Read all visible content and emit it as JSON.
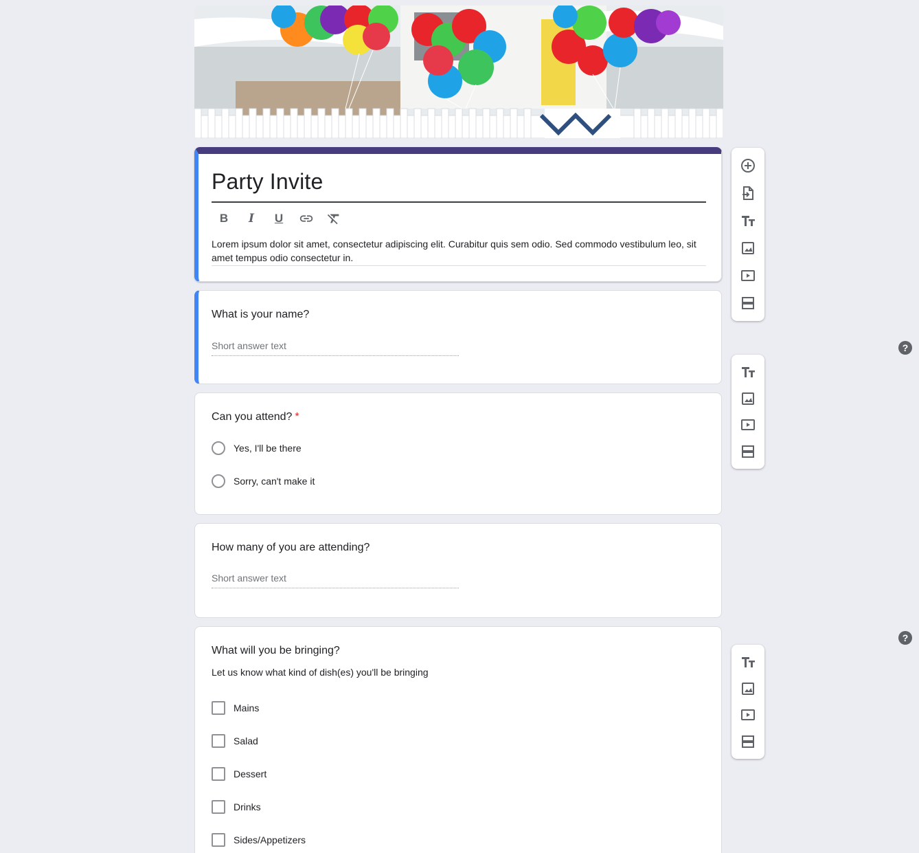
{
  "form": {
    "title": "Party Invite",
    "description": "Lorem ipsum dolor sit amet, consectetur adipiscing elit. Curabitur quis sem odio. Sed commodo vestibulum leo, sit amet tempus odio consectetur in.",
    "format_buttons": [
      "B",
      "I",
      "U",
      "link-icon",
      "clear-format-icon"
    ]
  },
  "questions": {
    "q1": {
      "title": "What is your name?",
      "placeholder": "Short answer text"
    },
    "q2": {
      "title": "Can you attend?",
      "required_mark": "*",
      "options": [
        "Yes,  I'll be there",
        "Sorry, can't make it"
      ]
    },
    "q3": {
      "title": "How many of you are attending?",
      "placeholder": "Short answer text"
    },
    "q4": {
      "title": "What will you be bringing?",
      "subtitle": "Let us know what kind of dish(es) you'll be bringing",
      "options": [
        "Mains",
        "Salad",
        "Dessert",
        "Drinks",
        "Sides/Appetizers"
      ]
    }
  },
  "toolbar_icons": [
    "add-question-icon",
    "import-questions-icon",
    "add-title-icon",
    "add-image-icon",
    "add-video-icon",
    "add-section-icon"
  ],
  "help_label": "?",
  "colors": {
    "background": "#ececf3",
    "theme_header": "#473c7e",
    "active_accent": "#4285f4",
    "required": "#d93025"
  }
}
